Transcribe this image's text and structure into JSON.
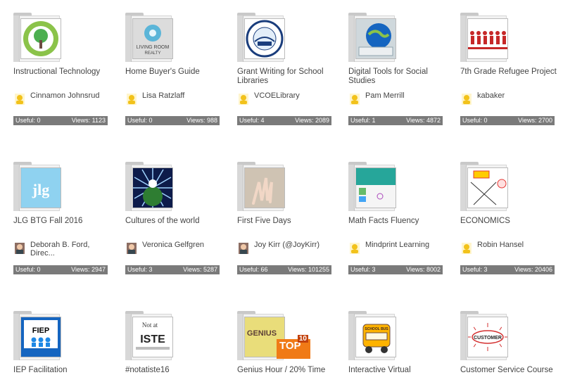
{
  "binders": [
    {
      "title": "Instructional Technology",
      "owner": "Cinnamon Johnsrud",
      "useful": "Useful: 0",
      "views": "Views: 1123",
      "thumb": "tree-seal",
      "avatar": "generic"
    },
    {
      "title": "Home Buyer's Guide",
      "owner": "Lisa Ratzlaff",
      "useful": "Useful: 0",
      "views": "Views: 988",
      "thumb": "living-room-realty",
      "avatar": "generic",
      "thumb_text": "LIVING ROOM\nREALTY"
    },
    {
      "title": "Grant Writing for School Libraries",
      "owner": "VCOELibrary",
      "useful": "Useful: 4",
      "views": "Views: 2089",
      "thumb": "office-of-education-seal",
      "avatar": "generic"
    },
    {
      "title": "Digital Tools for Social Studies",
      "owner": "Pam Merrill",
      "useful": "Useful: 1",
      "views": "Views: 4872",
      "thumb": "globe-keyboard",
      "avatar": "generic"
    },
    {
      "title": "7th Grade Refugee Project",
      "owner": "kabaker",
      "useful": "Useful: 0",
      "views": "Views: 2700",
      "thumb": "people-line",
      "avatar": "generic"
    },
    {
      "title": "JLG BTG Fall 2016",
      "owner": "Deborah B. Ford, Direc...",
      "useful": "Useful: 0",
      "views": "Views: 2947",
      "thumb": "jlg-logo",
      "avatar": "photo",
      "thumb_text": "jlg"
    },
    {
      "title": "Cultures of the world",
      "owner": "Veronica Gelfgren",
      "useful": "Useful: 3",
      "views": "Views: 5287",
      "thumb": "globe-burst",
      "avatar": "photo"
    },
    {
      "title": "First Five Days",
      "owner": "Joy Kirr (@JoyKirr)",
      "useful": "Useful: 66",
      "views": "Views: 101255",
      "thumb": "hand-sand",
      "avatar": "photo"
    },
    {
      "title": "Math Facts Fluency",
      "owner": "Mindprint Learning",
      "useful": "Useful: 3",
      "views": "Views: 8002",
      "thumb": "slide-teal",
      "avatar": "generic"
    },
    {
      "title": "ECONOMICS",
      "owner": "Robin Hansel",
      "useful": "Useful: 3",
      "views": "Views: 20406",
      "thumb": "econ-diagram",
      "avatar": "generic"
    },
    {
      "title": "IEP Facilitation",
      "owner": "",
      "useful": "",
      "views": "",
      "thumb": "fiep-logo",
      "avatar": "",
      "thumb_text": "FIEP"
    },
    {
      "title": "#notatiste16",
      "owner": "",
      "useful": "",
      "views": "",
      "thumb": "iste-logo",
      "avatar": "",
      "thumb_text": "ISTE"
    },
    {
      "title": "Genius Hour / 20% Time",
      "owner": "",
      "useful": "",
      "views": "",
      "thumb": "genius-paper",
      "avatar": "",
      "thumb_text": "GENIUS",
      "badge": "TOP",
      "badge_num": "10"
    },
    {
      "title": "Interactive Virtual",
      "owner": "",
      "useful": "",
      "views": "",
      "thumb": "school-bus",
      "avatar": "",
      "thumb_text": "SCHOOL BUS"
    },
    {
      "title": "Customer Service Course",
      "owner": "",
      "useful": "",
      "views": "",
      "thumb": "customer-drawing",
      "avatar": "",
      "thumb_text": "CUSTOMER"
    }
  ]
}
